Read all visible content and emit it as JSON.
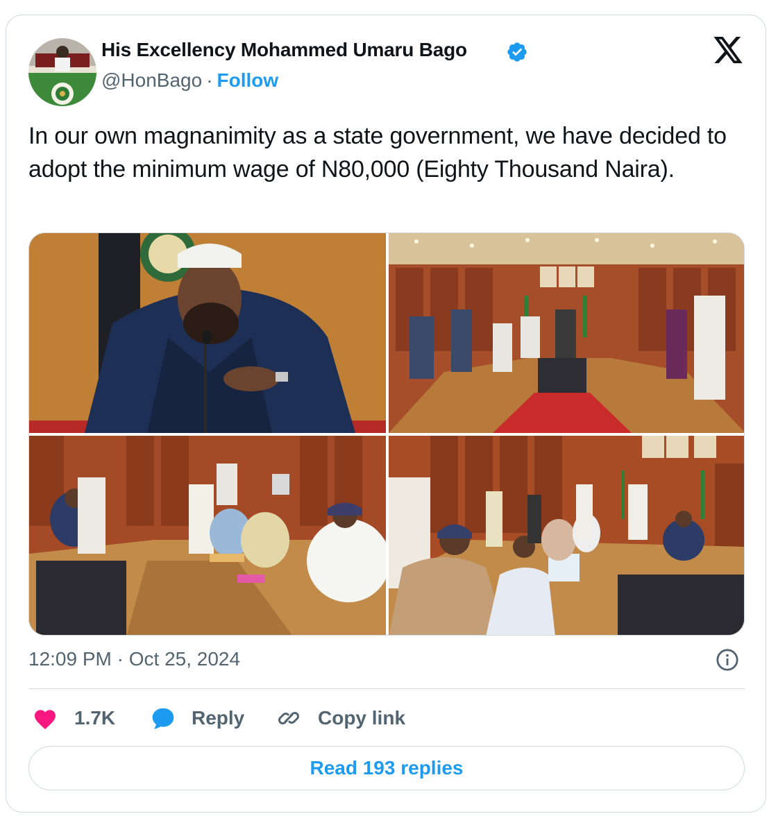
{
  "author": {
    "name": "His Excellency Mohammed Umaru Bago",
    "handle": "@HonBago",
    "separator": "·",
    "follow_label": "Follow",
    "verified_icon": "verified-badge-icon",
    "brand_color": "#1d9bf0"
  },
  "tweet": {
    "text": "In our own magnanimity as a state government, we have decided to adopt the minimum wage of N80,000 (Eighty Thousand Naira).",
    "time": "12:09 PM · Oct 25, 2024"
  },
  "media": {
    "count": 4
  },
  "engagement": {
    "likes": "1.7K",
    "reply_label": "Reply",
    "copy_link_label": "Copy link",
    "like_color": "#f91880"
  },
  "read_replies_label": "Read 193 replies"
}
